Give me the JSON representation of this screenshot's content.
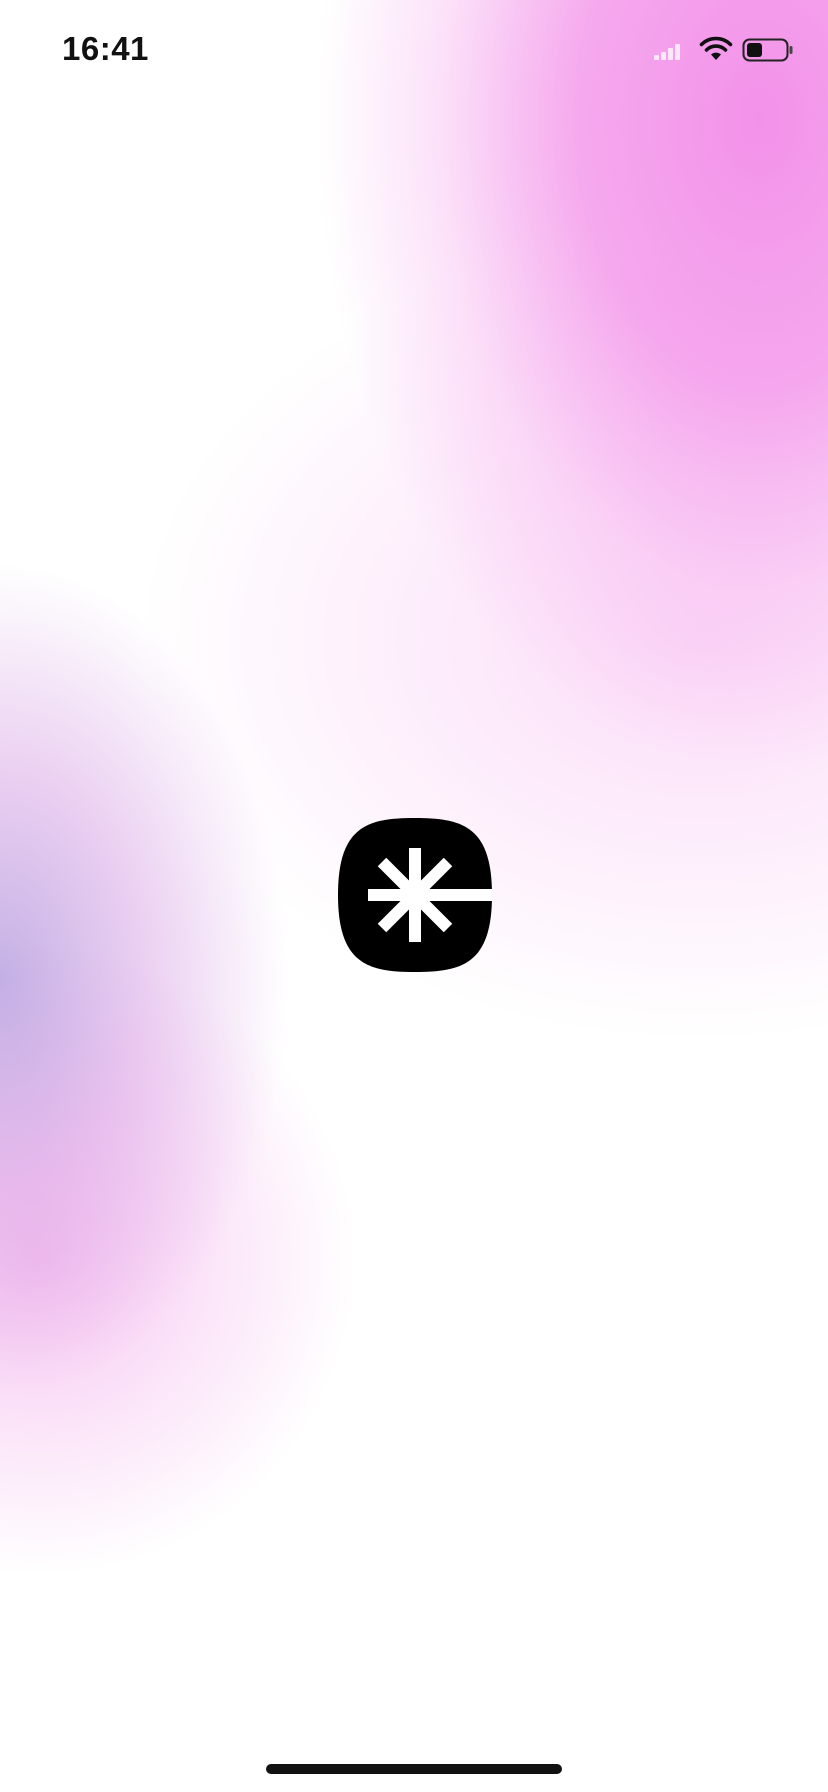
{
  "status_bar": {
    "time": "16:41",
    "signal_icon": "cellular-signal-icon",
    "wifi_icon": "wifi-icon",
    "battery_icon": "battery-icon",
    "battery_level": 0.4
  },
  "splash": {
    "logo_icon": "asterisk-app-logo-icon"
  },
  "colors": {
    "gradient_pink": "#f28ce8",
    "gradient_purple": "#b096dc",
    "logo_fill": "#000000",
    "text": "#111111"
  }
}
